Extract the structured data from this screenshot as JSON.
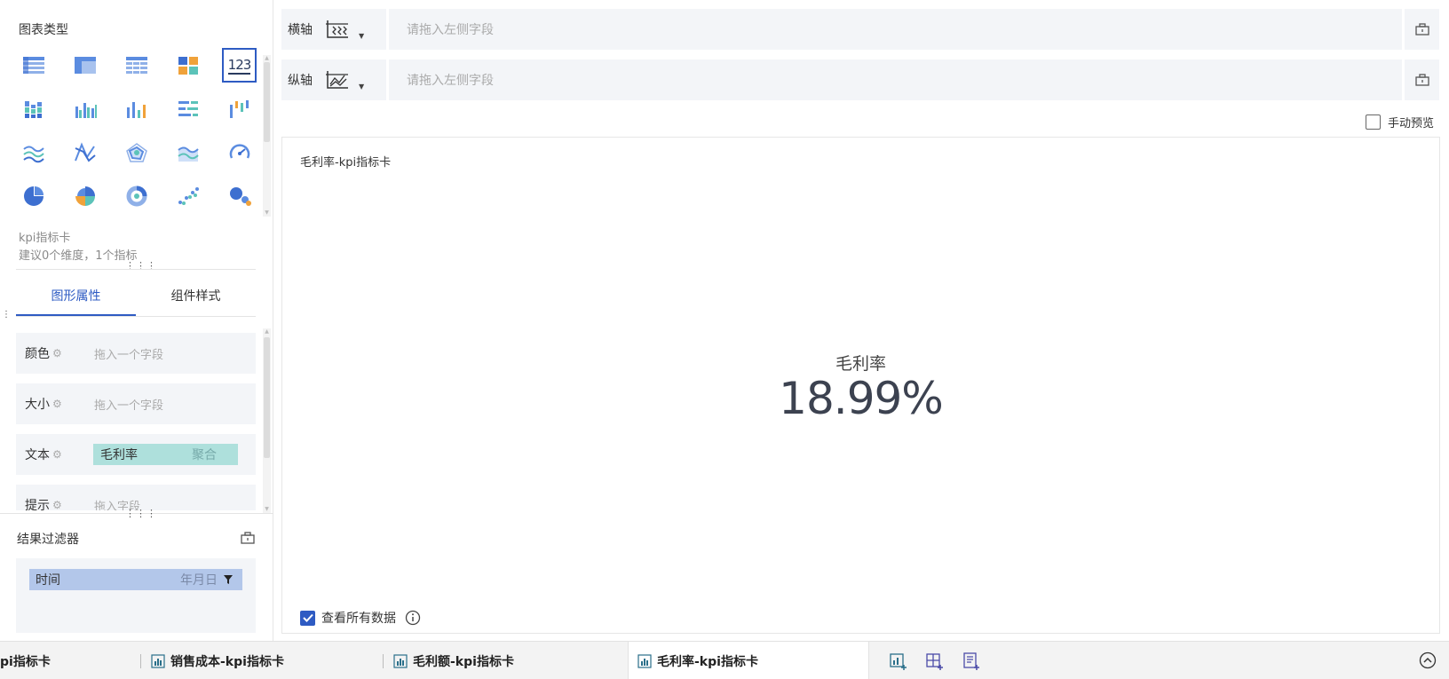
{
  "left_panel": {
    "chart_type_title": "图表类型",
    "chart_types": [
      {
        "icon": "table-icon"
      },
      {
        "icon": "cross-table-icon"
      },
      {
        "icon": "detail-table-icon"
      },
      {
        "icon": "card-icon"
      },
      {
        "icon": "kpi-card-icon",
        "text": "123",
        "active": true
      },
      {
        "icon": "stacked-bar-icon"
      },
      {
        "icon": "grouped-bar-icon"
      },
      {
        "icon": "column-chart-icon"
      },
      {
        "icon": "horizontal-bar-icon"
      },
      {
        "icon": "waterfall-icon"
      },
      {
        "icon": "line-chart-icon"
      },
      {
        "icon": "multi-line-icon"
      },
      {
        "icon": "radar-icon"
      },
      {
        "icon": "area-chart-icon"
      },
      {
        "icon": "gauge-icon"
      },
      {
        "icon": "pie-chart-icon"
      },
      {
        "icon": "rose-chart-icon"
      },
      {
        "icon": "donut-chart-icon"
      },
      {
        "icon": "scatter-icon"
      },
      {
        "icon": "bubble-icon"
      }
    ],
    "selected_type_name": "kpi指标卡",
    "selected_type_hint": "建议0个维度，1个指标",
    "tabs": [
      "图形属性",
      "组件样式"
    ],
    "properties": [
      {
        "label": "颜色",
        "placeholder": "拖入一个字段"
      },
      {
        "label": "大小",
        "placeholder": "拖入一个字段"
      },
      {
        "label": "文本",
        "field": "毛利率",
        "agg": "聚合"
      },
      {
        "label": "提示",
        "placeholder": "拖入字段"
      }
    ],
    "filter_title": "结果过滤器",
    "filter_field": "时间",
    "filter_granularity": "年月日"
  },
  "axes": {
    "x_label": "横轴",
    "y_label": "纵轴",
    "placeholder": "请拖入左侧字段"
  },
  "manual_preview": "手动预览",
  "chart": {
    "title": "毛利率-kpi指标卡",
    "kpi_label": "毛利率",
    "kpi_value": "18.99%",
    "view_all": "查看所有数据"
  },
  "sheet_tabs": [
    {
      "label": "pi指标卡",
      "active": false
    },
    {
      "label": "销售成本-kpi指标卡",
      "active": false
    },
    {
      "label": "毛利额-kpi指标卡",
      "active": false
    },
    {
      "label": "毛利率-kpi指标卡",
      "active": true
    }
  ],
  "colors": {
    "accent": "#2e5bc3",
    "field_chip": "#aee0dc",
    "filter_chip": "#b3c7ea"
  }
}
